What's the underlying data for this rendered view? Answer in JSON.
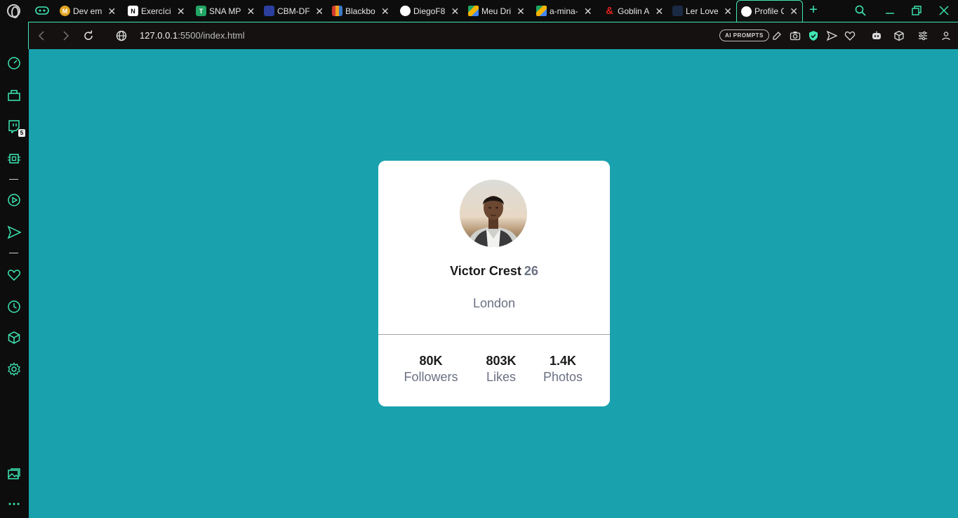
{
  "browser": {
    "tabs": [
      {
        "title": "Dev em",
        "favicon_color": "#e0a422",
        "favicon_glyph": "M"
      },
      {
        "title": "Exercíci",
        "favicon_color": "#ffffff",
        "favicon_glyph": "N"
      },
      {
        "title": "SNA MP",
        "favicon_color": "#21a464",
        "favicon_glyph": "T"
      },
      {
        "title": "CBM-DF",
        "favicon_color": "#2a3f9e",
        "favicon_glyph": ""
      },
      {
        "title": "Blackbo",
        "favicon_color": "#d33a2c",
        "favicon_glyph": ""
      },
      {
        "title": "DiegoF8",
        "favicon_color": "#ffffff",
        "favicon_glyph": ""
      },
      {
        "title": "Meu Dri",
        "favicon_color": "#f4b400",
        "favicon_glyph": ""
      },
      {
        "title": "a-mina-",
        "favicon_color": "#1fa463",
        "favicon_glyph": ""
      },
      {
        "title": "Goblin A",
        "favicon_color": "#e0221c",
        "favicon_glyph": "&"
      },
      {
        "title": "Ler Love",
        "favicon_color": "#1b2a44",
        "favicon_glyph": ""
      },
      {
        "title": "Profile C",
        "favicon_color": "#ffffff",
        "favicon_glyph": "",
        "active": true
      }
    ],
    "url": {
      "host": "127.0.0.1",
      "rest": ":5500/index.html"
    },
    "ai_prompts_label": "AI PROMPTS",
    "sidebar_badge": "5",
    "accent": "#3fe8b5"
  },
  "profile": {
    "name": "Victor Crest",
    "age": "26",
    "city": "London",
    "stats": [
      {
        "value": "80K",
        "label": "Followers"
      },
      {
        "value": "803K",
        "label": "Likes"
      },
      {
        "value": "1.4K",
        "label": "Photos"
      }
    ]
  },
  "colors": {
    "page_background": "#19a2ae",
    "card_background": "#ffffff",
    "muted_text": "#6b7082"
  }
}
